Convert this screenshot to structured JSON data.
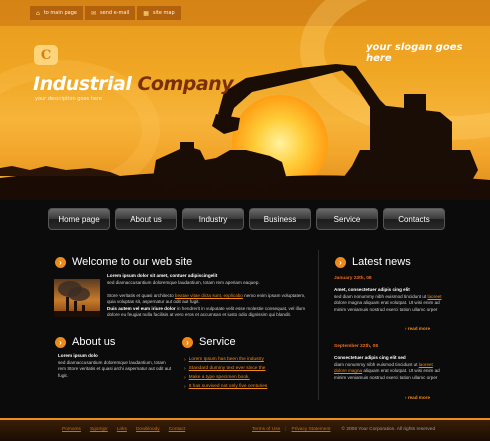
{
  "header": {
    "top_links": [
      {
        "label": "to main page",
        "icon": "home-icon"
      },
      {
        "label": "send e-mail",
        "icon": "mail-icon"
      },
      {
        "label": "site map",
        "icon": "sitemap-icon"
      }
    ],
    "company_word1": "Industrial",
    "company_word2": "Company",
    "tagline": "your description goes here",
    "slogan": "your slogan goes here"
  },
  "nav": [
    {
      "label": "Home page"
    },
    {
      "label": "About us"
    },
    {
      "label": "Industry"
    },
    {
      "label": "Business"
    },
    {
      "label": "Service"
    },
    {
      "label": "Contacts"
    }
  ],
  "welcome": {
    "title": "Welcome to our web site",
    "lead": "Lorem ipsum dolor sit amet, contuer adipiscingelit",
    "p1": "sed diamaccusantium doloremque laudantium, totam rem aperiam eaquep.",
    "p2_a": "Store veritatis et quasi architecto ",
    "p2_link": "beatae vitae dicta sunt, explicabo",
    "p2_b": " nemo enim ipsam voluptatem, quia voluptas sit, aspernatur aut odit aut fugit.",
    "p3_bold": "Duis autem vel eum iriure dolor",
    "p3_rest": " in hendrerit in vulputate velit esse molestie consequat, vel illum dolore eu feugiat nulla facilisis at vero eros et accumsan et iusto odio dignissim qui blandit."
  },
  "about": {
    "title": "About us",
    "lead": "Lorem ipsum dolo",
    "text": "sed diamaccusantium doloremque laudantium, totam rem Store veritatis et quasi archi aspernatur aut odit aut fugit."
  },
  "service": {
    "title": "Service",
    "items": [
      "Lorem Ipsum has been the industry",
      "Standard dummy text ever since the",
      "Make a type specimen book.",
      "It has survived not only five centuries"
    ]
  },
  "news": {
    "title": "Latest news",
    "items": [
      {
        "date": "January 23th, 08",
        "lead": "Amet, consectetuer adipis cing elit",
        "text_a": "sed diam nonummy nibh euismod tincidunt ut ",
        "link": "laoreet",
        "text_b": " dolore magna aliquam erat volutpat.  Ut wisi enim ad minim veniamuis nostrud exerci tation ullamc orper",
        "more": "read more"
      },
      {
        "date": "September 22th, 08",
        "lead": "Consectetuer adipis cing elit sed",
        "text_a": "diam nonummy nibh euismod tincidunt ut ",
        "link": "laoreet dolore magna",
        "text_b": " aliquam erat volutpat.  Ut wisi enim ad minim veniamuis nostrud exerci tation ullamc orper",
        "more": "read more"
      }
    ]
  },
  "footer": {
    "links": [
      "Pomoms",
      "Sgomjpr",
      "Lnks",
      "Dowbloody",
      "Contact"
    ],
    "terms": "Terms of Use",
    "privacy": "Privacy Statement",
    "sep": "|",
    "copyright": "© 2008 Your Corporation.  All rights reserved"
  },
  "colors": {
    "accent": "#ee8a1a",
    "hero": "#f0a623",
    "background": "#0b0b0b"
  }
}
